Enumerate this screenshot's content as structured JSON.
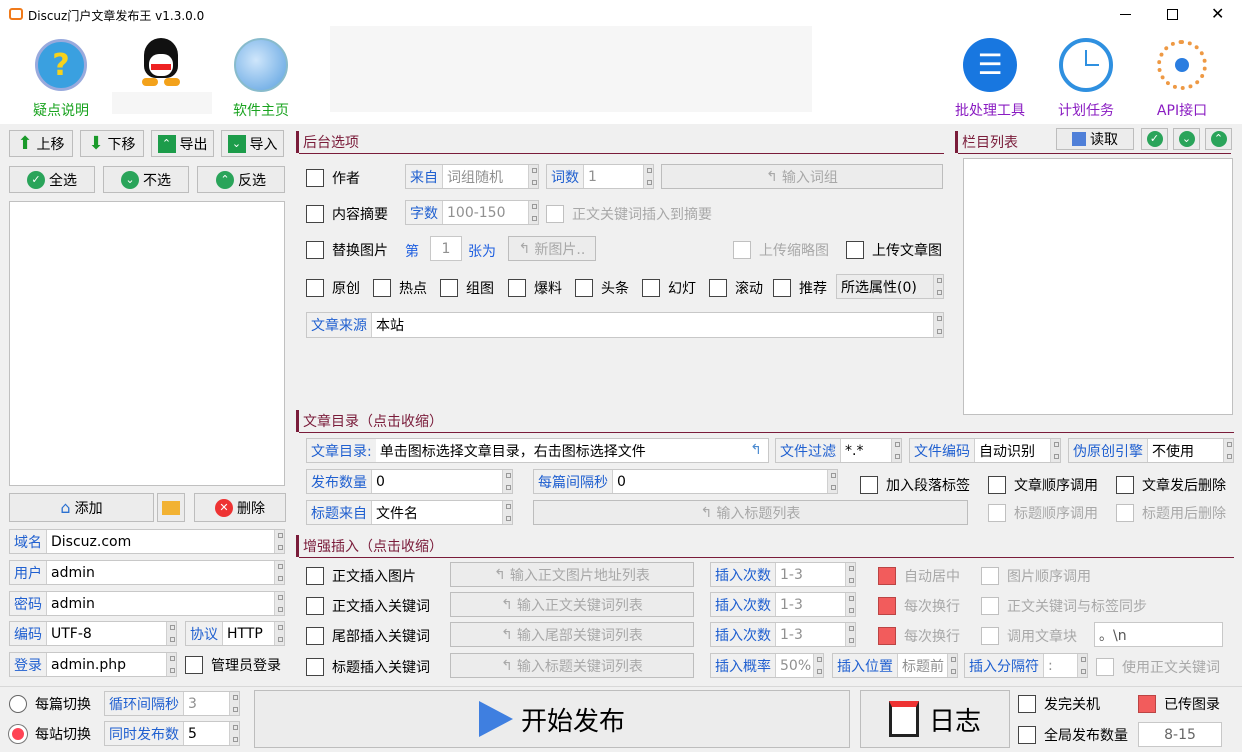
{
  "title": "Discuz门户文章发布王 v1.3.0.0",
  "toolbar": {
    "faq": "疑点说明",
    "home": "软件主页",
    "batch": "批处理工具",
    "plan": "计划任务",
    "api": "API接口"
  },
  "left": {
    "up": "上移",
    "down": "下移",
    "export": "导出",
    "import": "导入",
    "all": "全选",
    "none": "不选",
    "invert": "反选",
    "add": "添加",
    "delete": "删除",
    "domain_k": "域名",
    "domain_v": "Discuz.com",
    "user_k": "用户",
    "user_v": "admin",
    "pass_k": "密码",
    "pass_v": "admin",
    "enc_k": "编码",
    "enc_v": "UTF-8",
    "proto_k": "协议",
    "proto_v": "HTTP",
    "login_k": "登录",
    "login_v": "admin.php",
    "admin_login": "管理员登录"
  },
  "backend": {
    "title": "后台选项",
    "author": "作者",
    "from_k": "来自",
    "from_v": "词组随机",
    "words_k": "词数",
    "words_v": "1",
    "input_words": "输入词组",
    "summary": "内容摘要",
    "chars_k": "字数",
    "chars_v": "100-150",
    "kw_summary": "正文关键词插入到摘要",
    "replace_img": "替换图片",
    "nth": "第",
    "nth_v": "1",
    "as": "张为",
    "new_img": "新图片..",
    "upload_thumb": "上传缩略图",
    "upload_img": "上传文章图",
    "attrs": [
      "原创",
      "热点",
      "组图",
      "爆料",
      "头条",
      "幻灯",
      "滚动",
      "推荐"
    ],
    "attr_btn": "所选属性(0)",
    "source_k": "文章来源",
    "source_v": "本站"
  },
  "column": {
    "title": "栏目列表",
    "read": "读取"
  },
  "dir": {
    "title": "文章目录（点击收缩）",
    "dir_k": "文章目录:",
    "dir_v": "单击图标选择文章目录，右击图标选择文件",
    "filter_k": "文件过滤",
    "filter_v": "*.*",
    "enc_k": "文件编码",
    "enc_v": "自动识别",
    "orig_k": "伪原创引擎",
    "orig_v": "不使用",
    "count_k": "发布数量",
    "count_v": "0",
    "interval_k": "每篇间隔秒",
    "interval_v": "0",
    "para": "加入段落标签",
    "seq": "文章顺序调用",
    "del_after": "文章发后删除",
    "tsrc_k": "标题来自",
    "tsrc_v": "文件名",
    "input_titles": "输入标题列表",
    "tseq": "标题顺序调用",
    "tdel": "标题用后删除"
  },
  "enh": {
    "title": "增强插入（点击收缩）",
    "r1": "正文插入图片",
    "r1b": "输入正文图片地址列表",
    "r2": "正文插入关键词",
    "r2b": "输入正文关键词列表",
    "r3": "尾部插入关键词",
    "r3b": "输入尾部关键词列表",
    "r4": "标题插入关键词",
    "r4b": "输入标题关键词列表",
    "times_k": "插入次数",
    "times_v": "1-3",
    "prob_k": "插入概率",
    "prob_v": "50%",
    "pos_k": "插入位置",
    "pos_v": "标题前",
    "sep_k": "插入分隔符",
    "sep_v": ":",
    "center": "自动居中",
    "wrap1": "每次换行",
    "wrap2": "每次换行",
    "imgseq": "图片顺序调用",
    "kwsync": "正文关键词与标签同步",
    "block": "调用文章块",
    "block_v": "。\\n",
    "use_kw": "使用正文关键词"
  },
  "bottom": {
    "per_post": "每篇切换",
    "loop_k": "循环间隔秒",
    "loop_v": "3",
    "per_site": "每站切换",
    "conc_k": "同时发布数",
    "conc_v": "5",
    "start": "开始发布",
    "log": "日志",
    "shutdown": "发完关机",
    "uploaded": "已传图录",
    "global": "全局发布数量",
    "global_v": "8-15"
  }
}
